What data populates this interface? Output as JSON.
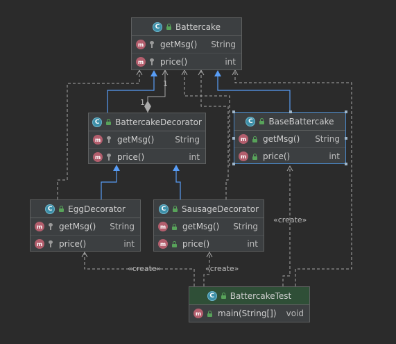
{
  "colors": {
    "background": "#2b2b2b",
    "node_fill": "#3c3f41",
    "node_border": "#5e6060",
    "selected_border": "#4a88c7",
    "inheritance_arrow": "#589df6",
    "dependency_line": "#aaaaaa",
    "class_icon": "#3d8fa8",
    "method_icon": "#b35e6d",
    "public_lock": "#58a35a",
    "test_header": "#2f4f37"
  },
  "icons": {
    "class_letter": "C",
    "method_letter": "m"
  },
  "nodes": {
    "battercake": {
      "name": "Battercake",
      "methods": [
        {
          "name": "getMsg()",
          "type": "String",
          "visibility": "protected"
        },
        {
          "name": "price()",
          "type": "int",
          "visibility": "protected"
        }
      ]
    },
    "decorator": {
      "name": "BattercakeDecorator",
      "methods": [
        {
          "name": "getMsg()",
          "type": "String",
          "visibility": "protected"
        },
        {
          "name": "price()",
          "type": "int",
          "visibility": "protected"
        }
      ]
    },
    "base": {
      "name": "BaseBattercake",
      "methods": [
        {
          "name": "getMsg()",
          "type": "String",
          "visibility": "public"
        },
        {
          "name": "price()",
          "type": "int",
          "visibility": "public"
        }
      ]
    },
    "egg": {
      "name": "EggDecorator",
      "methods": [
        {
          "name": "getMsg()",
          "type": "String",
          "visibility": "protected"
        },
        {
          "name": "price()",
          "type": "int",
          "visibility": "protected"
        }
      ]
    },
    "sausage": {
      "name": "SausageDecorator",
      "methods": [
        {
          "name": "getMsg()",
          "type": "String",
          "visibility": "public"
        },
        {
          "name": "price()",
          "type": "int",
          "visibility": "public"
        }
      ]
    },
    "test": {
      "name": "BattercakeTest",
      "methods": [
        {
          "name": "main(String[])",
          "type": "void",
          "visibility": "public"
        }
      ]
    }
  },
  "edge_labels": {
    "multiplicity_target": "1",
    "multiplicity_source": "1",
    "create_base": "«create»",
    "create_egg": "«create»",
    "create_sausage": "«create»"
  }
}
